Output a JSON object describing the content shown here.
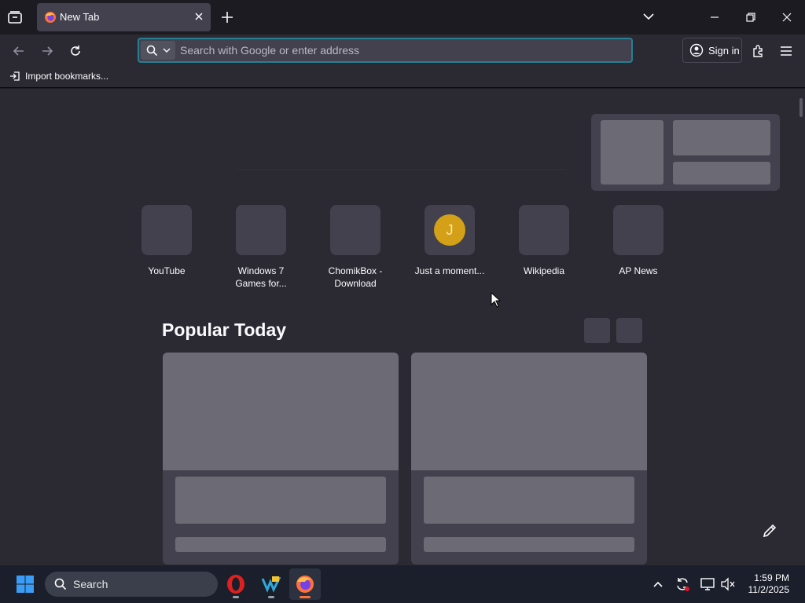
{
  "tab": {
    "title": "New Tab"
  },
  "urlbar": {
    "placeholder": "Search with Google or enter address"
  },
  "account": {
    "signin_label": "Sign in"
  },
  "bookmarks": {
    "import_label": "Import bookmarks..."
  },
  "top_sites": [
    {
      "label": "YouTube"
    },
    {
      "label": "Windows 7\nGames for..."
    },
    {
      "label": "ChomikBox -\nDownload"
    },
    {
      "label": "Just a moment...",
      "letter": "J"
    },
    {
      "label": "Wikipedia"
    },
    {
      "label": "AP News"
    }
  ],
  "popular": {
    "title": "Popular Today"
  },
  "taskbar": {
    "search_label": "Search",
    "time": "1:59 PM",
    "date": "11/2/2025"
  },
  "colors": {
    "accent": "#00ddff",
    "letter_icon": "#d4a017",
    "windows_blue": "#3b9cf5"
  }
}
